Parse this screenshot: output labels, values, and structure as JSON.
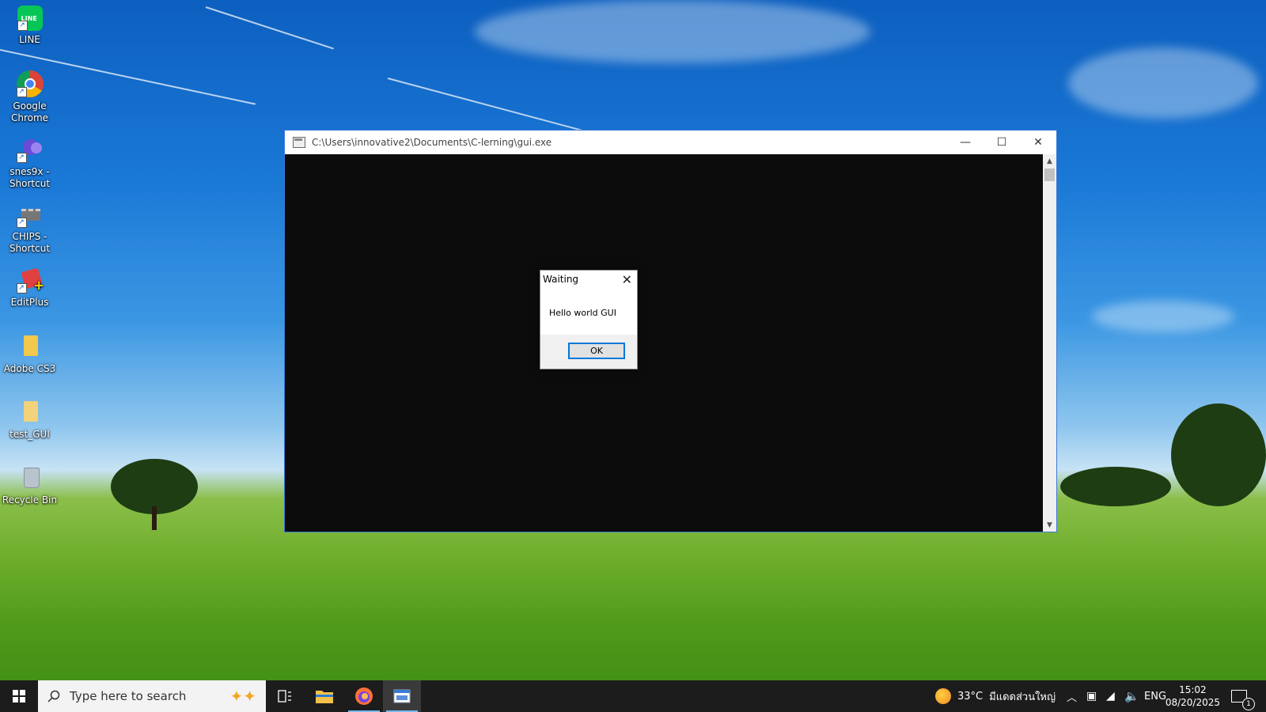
{
  "desktop_icons": [
    {
      "label": "LINE",
      "icon": "line-app-icon",
      "color": "#06c755"
    },
    {
      "label": "Google Chrome",
      "icon": "chrome-icon",
      "color": "#db4437"
    },
    {
      "label": "snes9x - Shortcut",
      "icon": "snes9x-icon",
      "color": "#6a4bd8"
    },
    {
      "label": "CHIPS - Shortcut",
      "icon": "chips-icon",
      "color": "#777777"
    },
    {
      "label": "EditPlus",
      "icon": "editplus-icon",
      "color": "#e04040"
    },
    {
      "label": "Adobe CS3",
      "icon": "folder-icon",
      "color": "#f2c94c"
    },
    {
      "label": "test_GUI",
      "icon": "folder-icon",
      "color": "#f2d27a"
    },
    {
      "label": "Recycle Bin",
      "icon": "recycle-bin-icon",
      "color": "#b9c3cc"
    }
  ],
  "console_window": {
    "title": "C:\\Users\\innovative2\\Documents\\C-lerning\\gui.exe",
    "minimize": "—",
    "maximize": "☐",
    "close": "✕"
  },
  "message_box": {
    "title": "Waiting",
    "text": "Hello world GUI",
    "ok_label": "OK",
    "close": "✕"
  },
  "taskbar": {
    "search_placeholder": "Type here to search",
    "apps": [
      {
        "name": "task-view",
        "icon": "task-view-icon"
      },
      {
        "name": "file-explorer",
        "icon": "folder-icon"
      },
      {
        "name": "firefox",
        "icon": "firefox-icon"
      },
      {
        "name": "console",
        "icon": "console-icon"
      }
    ],
    "weather_temp": "33°C",
    "weather_text": "มีแดดส่วนใหญ่",
    "language": "ENG",
    "time": "15:02",
    "date": "08/20/2025",
    "notification_count": "1"
  }
}
